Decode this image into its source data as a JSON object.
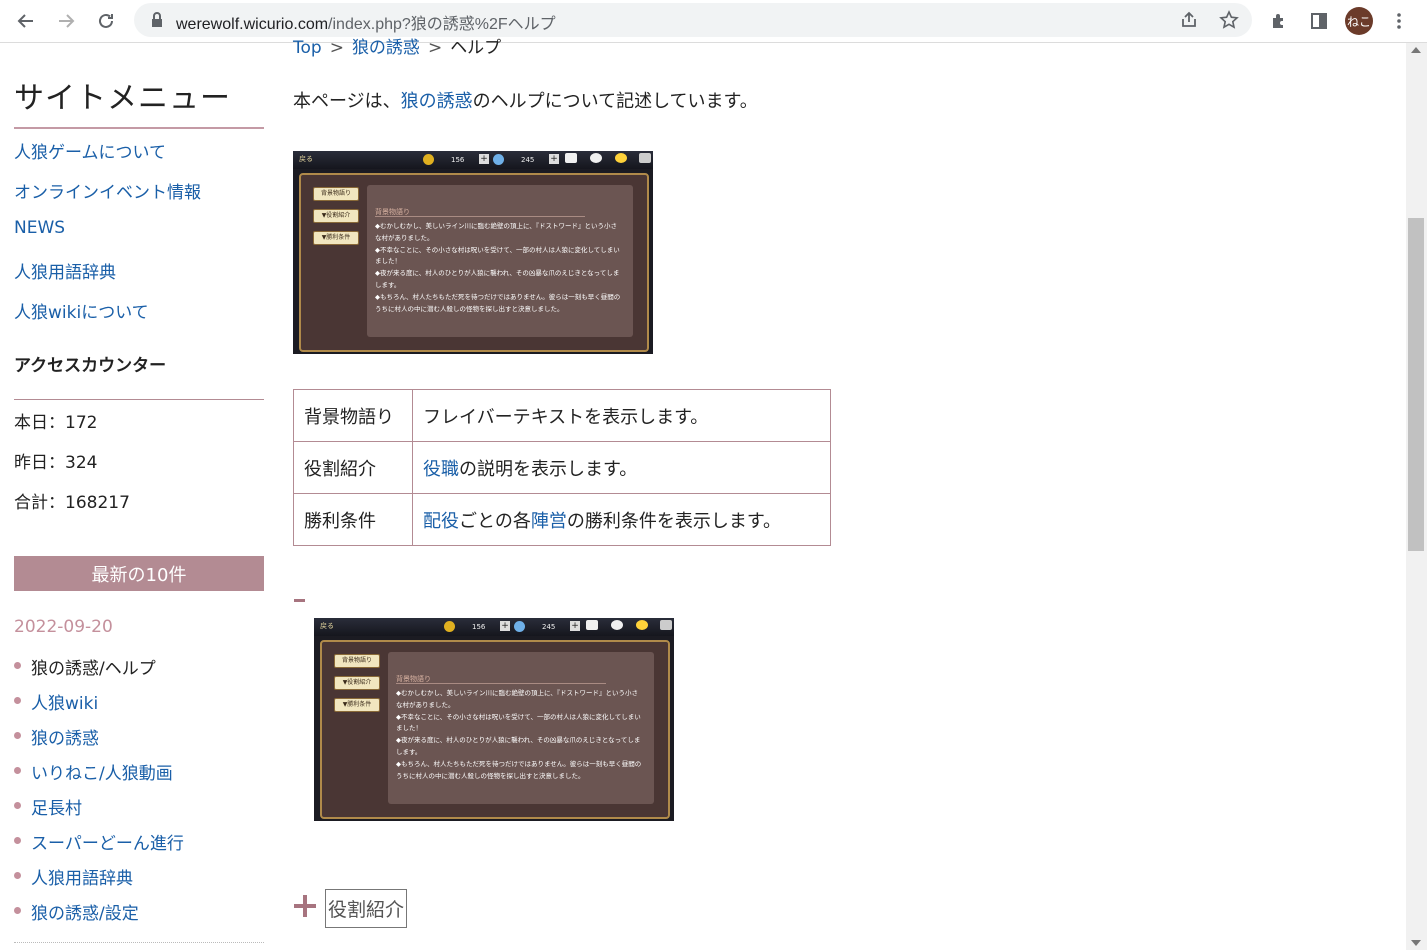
{
  "browser": {
    "url_host": "werewolf.wicurio.com",
    "url_rest": "/index.php?狼の誘惑%2Fヘルプ",
    "avatar_text": "ねこ"
  },
  "sidebar": {
    "title": "サイトメニュー",
    "menu": [
      "人狼ゲームについて",
      "オンラインイベント情報",
      "NEWS",
      "人狼用語辞典",
      "人狼wikiについて"
    ],
    "counter_title": "アクセスカウンター",
    "counter": {
      "today": "本日：172",
      "yesterday": "昨日：324",
      "total": "合計：168217"
    },
    "latest_title": "最新の10件",
    "latest_date": "2022-09-20",
    "latest_items": [
      "狼の誘惑/ヘルプ",
      "人狼wiki",
      "狼の誘惑",
      "いりねこ/人狼動画",
      "足長村",
      "スーパーどーん進行",
      "人狼用語辞典",
      "狼の誘惑/設定"
    ]
  },
  "main": {
    "breadcrumb": [
      "Top",
      "狼の誘惑",
      "ヘルプ"
    ],
    "breadcrumb_sep": ">",
    "intro_prefix": "本ページは、",
    "intro_link": "狼の誘惑",
    "intro_suffix": "のヘルプについて記述しています。",
    "screenshot": {
      "back": "戻る",
      "coins": "156",
      "gems": "245",
      "buttons": [
        "背景物語り",
        "▼役割紹介",
        "▼勝利条件"
      ],
      "panel_title": "背景物語り",
      "panel_lines": [
        "◆むかしむかし、美しいライン川に臨む絶壁の頂上に、『ドストワード』という小さな村がありました。",
        "◆不幸なことに、その小さな村は呪いを受けて、一部の村人は人狼に変化してしまいました！",
        "◆夜が来る度に、村人のひとりが人狼に襲われ、その凶暴な爪のえじきとなってしまします。",
        "◆もちろん、村人たちもただ死を待つだけではありません。彼らは一刻も早く昼間のうちに村人の中に潜む人殺しの怪物を探し出すと決意しました。"
      ]
    },
    "table": [
      {
        "term": "背景物語り",
        "desc_parts": [
          {
            "text": "フレイバーテキストを表示します。",
            "link": false
          }
        ]
      },
      {
        "term": "役割紹介",
        "desc_parts": [
          {
            "text": "役職",
            "link": true
          },
          {
            "text": "の説明を表示します。",
            "link": false
          }
        ]
      },
      {
        "term": "勝利条件",
        "desc_parts": [
          {
            "text": "配役",
            "link": true
          },
          {
            "text": "ごとの各",
            "link": false
          },
          {
            "text": "陣営",
            "link": true
          },
          {
            "text": "の勝利条件を表示します。",
            "link": false
          }
        ]
      }
    ],
    "toggle_label": "役割紹介"
  }
}
